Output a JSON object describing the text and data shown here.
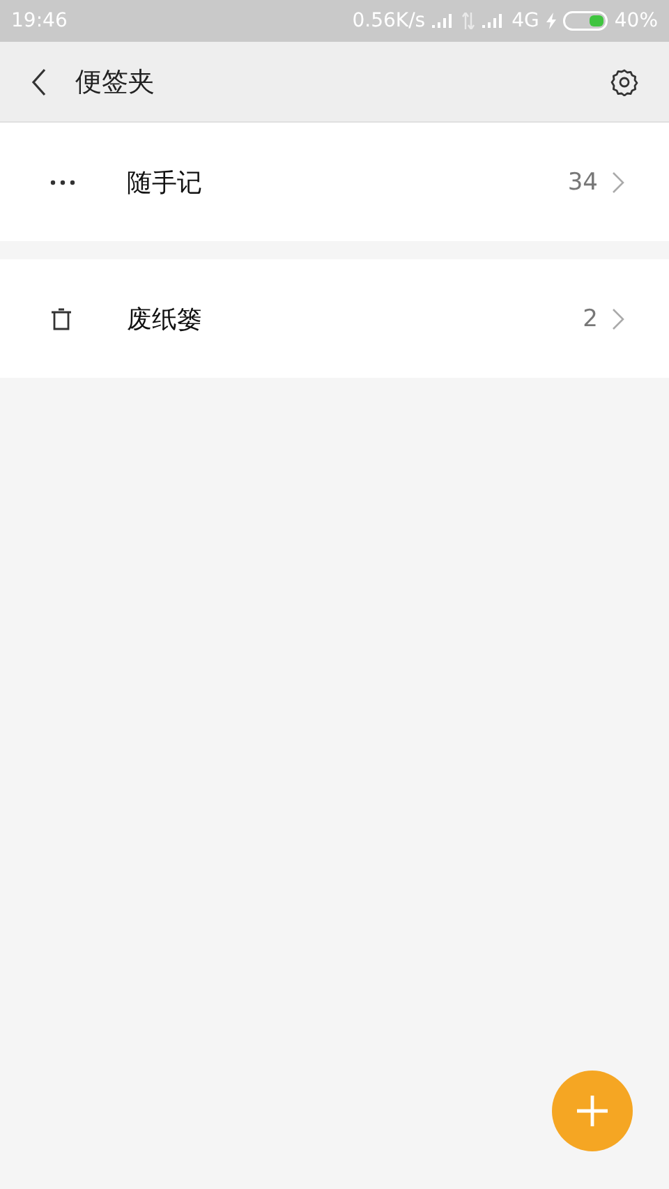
{
  "status_bar": {
    "time": "19:46",
    "speed": "0.56K/s",
    "network": "4G",
    "battery": "40%"
  },
  "header": {
    "title": "便签夹"
  },
  "folders": [
    {
      "kind": "notes",
      "name": "随手记",
      "count": "34"
    },
    {
      "kind": "trash",
      "name": "废纸篓",
      "count": "2"
    }
  ]
}
